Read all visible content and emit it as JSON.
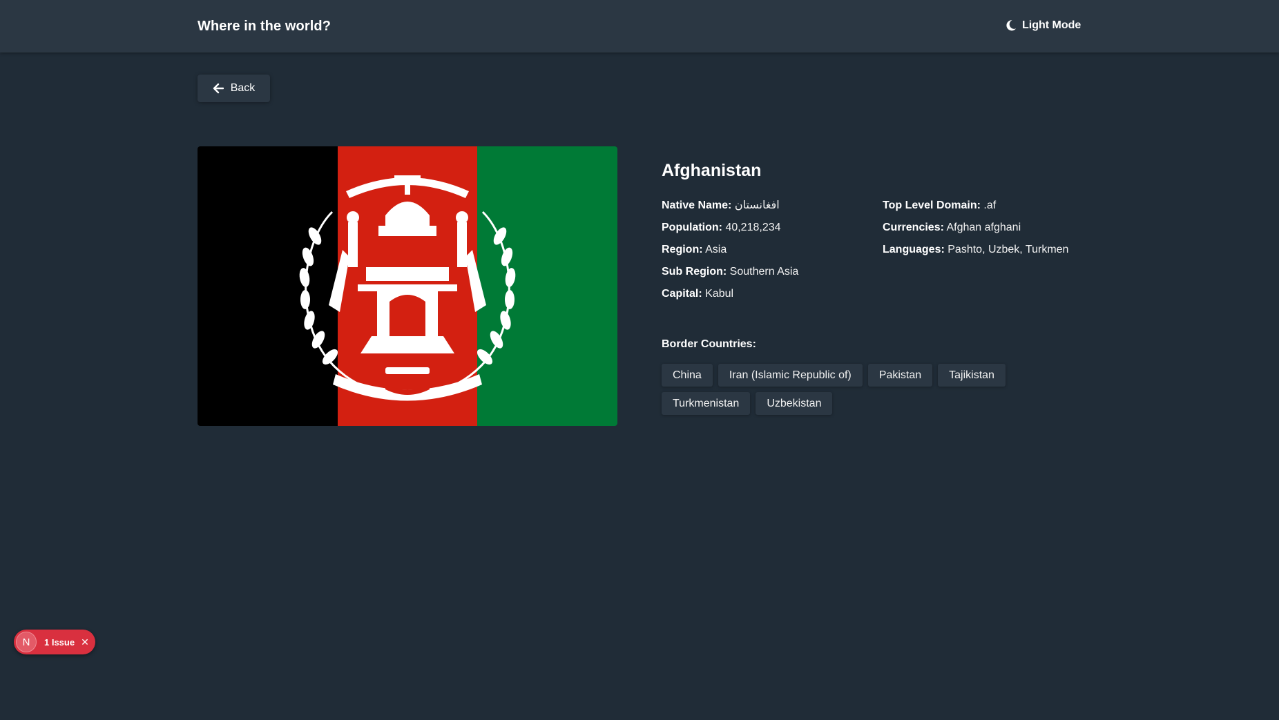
{
  "header": {
    "title": "Where in the world?",
    "theme_toggle_label": "Light Mode"
  },
  "back_button": {
    "label": "Back"
  },
  "country": {
    "name": "Afghanistan",
    "flag_colors": [
      "#000000",
      "#d32011",
      "#007a36"
    ],
    "info_left": [
      {
        "key": "Native Name:",
        "value": "افغانستان"
      },
      {
        "key": "Population:",
        "value": "40,218,234"
      },
      {
        "key": "Region:",
        "value": "Asia"
      },
      {
        "key": "Sub Region:",
        "value": "Southern Asia"
      },
      {
        "key": "Capital:",
        "value": "Kabul"
      }
    ],
    "info_right": [
      {
        "key": "Top Level Domain:",
        "value": ".af"
      },
      {
        "key": "Currencies:",
        "value": "Afghan afghani"
      },
      {
        "key": "Languages:",
        "value": "Pashto, Uzbek, Turkmen"
      }
    ],
    "border_label": "Border Countries:",
    "border_countries": [
      "China",
      "Iran (Islamic Republic of)",
      "Pakistan",
      "Tajikistan",
      "Turkmenistan",
      "Uzbekistan"
    ]
  },
  "dev_badge": {
    "logo": "N",
    "label": "1 Issue",
    "close_glyph": "✕"
  },
  "colors": {
    "background": "#202c37",
    "element": "#2b3743",
    "badge": "#d9303f"
  }
}
